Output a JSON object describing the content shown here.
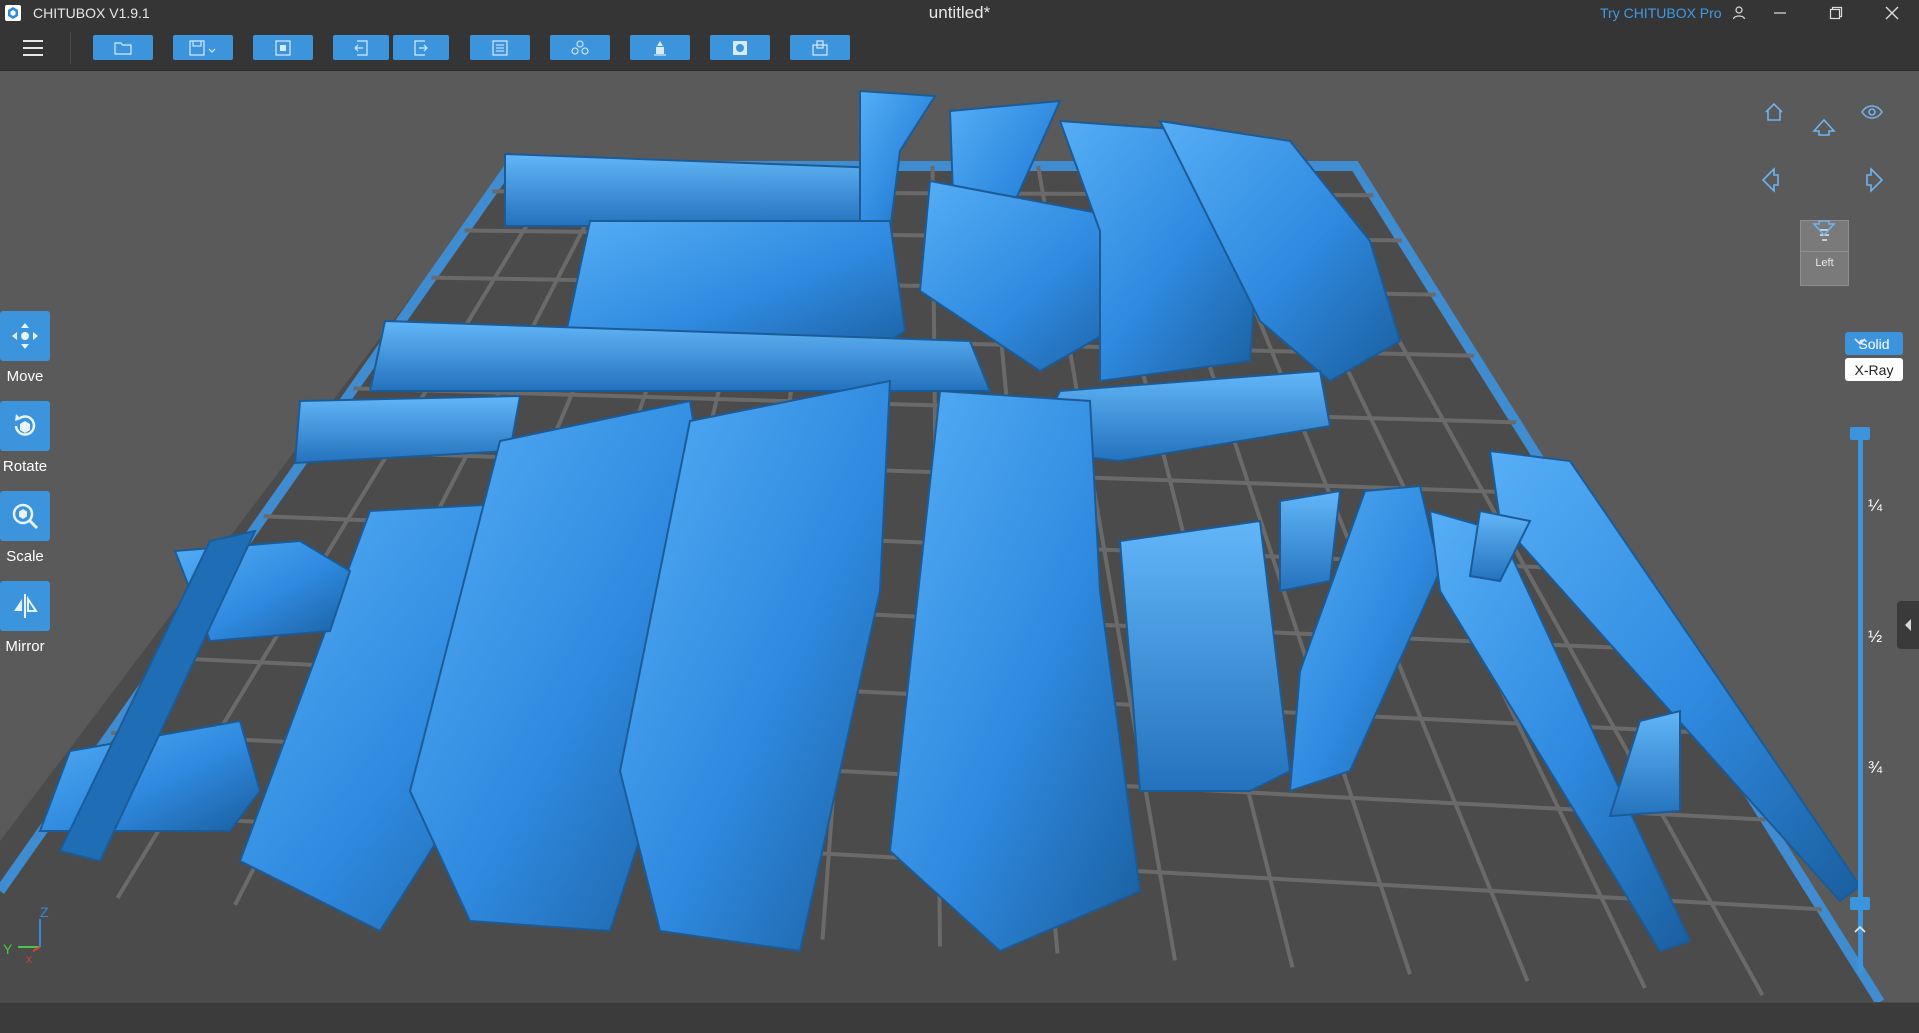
{
  "window": {
    "app_name": "CHITUBOX V1.9.1",
    "document_title": "untitled*",
    "promo_link": "Try CHITUBOX Pro"
  },
  "colors": {
    "accent": "#3c94dd",
    "model": "#2f8ae0",
    "background": "#5a5a5a",
    "plate": "#4b4b4b"
  },
  "toolbar": {
    "buttons": [
      {
        "name": "open-file",
        "icon": "folder-icon"
      },
      {
        "name": "save-file",
        "icon": "save-icon"
      },
      {
        "name": "select-all",
        "icon": "select-icon"
      },
      {
        "name": "undo",
        "icon": "undo-icon"
      },
      {
        "name": "redo",
        "icon": "redo-icon"
      },
      {
        "name": "model-list",
        "icon": "list-icon"
      },
      {
        "name": "layout",
        "icon": "arrange-icon"
      },
      {
        "name": "support",
        "icon": "support-icon"
      },
      {
        "name": "hollow",
        "icon": "hollow-icon"
      },
      {
        "name": "dig-hole",
        "icon": "hole-icon"
      }
    ]
  },
  "tools": {
    "move": "Move",
    "rotate": "Rotate",
    "scale": "Scale",
    "mirror": "Mirror"
  },
  "view": {
    "cube_face": "Left",
    "mode_solid": "Solid",
    "mode_xray": "X-Ray"
  },
  "slider": {
    "marks": [
      "¼",
      "½",
      "¾"
    ],
    "top_value": 1,
    "bottom_value": 0
  },
  "axes": {
    "x": "X",
    "y": "Y",
    "z": "Z"
  }
}
